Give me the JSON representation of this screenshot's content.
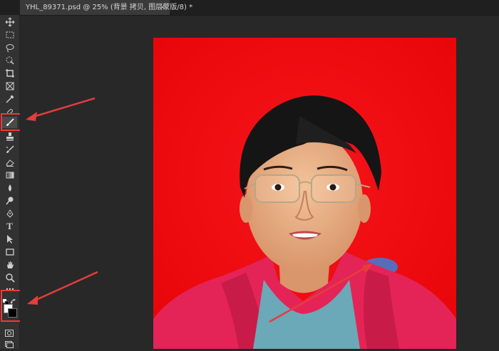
{
  "tab": {
    "title": "YHL_89371.psd @ 25% (背景 拷贝, 图层蒙版/8) *",
    "close_symbol": "×"
  },
  "toolbar": {
    "tools": [
      {
        "name": "move-tool",
        "icon": "move-icon"
      },
      {
        "name": "marquee-tool",
        "icon": "marquee-icon"
      },
      {
        "name": "lasso-tool",
        "icon": "lasso-icon"
      },
      {
        "name": "quick-select-tool",
        "icon": "quick-select-icon"
      },
      {
        "name": "crop-tool",
        "icon": "crop-icon"
      },
      {
        "name": "frame-tool",
        "icon": "frame-icon"
      },
      {
        "name": "eyedropper-tool",
        "icon": "eyedropper-icon"
      },
      {
        "name": "healing-brush-tool",
        "icon": "healing-icon"
      },
      {
        "name": "brush-tool",
        "icon": "brush-icon",
        "active": true
      },
      {
        "name": "clone-stamp-tool",
        "icon": "stamp-icon"
      },
      {
        "name": "history-brush-tool",
        "icon": "history-brush-icon"
      },
      {
        "name": "eraser-tool",
        "icon": "eraser-icon"
      },
      {
        "name": "gradient-tool",
        "icon": "gradient-icon"
      },
      {
        "name": "blur-tool",
        "icon": "blur-icon"
      },
      {
        "name": "dodge-tool",
        "icon": "dodge-icon"
      },
      {
        "name": "pen-tool",
        "icon": "pen-icon"
      },
      {
        "name": "type-tool",
        "icon": "type-icon",
        "label": "T"
      },
      {
        "name": "path-select-tool",
        "icon": "path-select-icon"
      },
      {
        "name": "rectangle-tool",
        "icon": "rectangle-icon"
      },
      {
        "name": "hand-tool",
        "icon": "hand-icon"
      },
      {
        "name": "zoom-tool",
        "icon": "zoom-icon"
      },
      {
        "name": "more-tools",
        "icon": "ellipsis-icon"
      }
    ],
    "foreground_color": "#ffffff",
    "background_color": "#000000"
  },
  "colors": {
    "annotation": "#e63c3c",
    "photo_background": "#f20c10"
  }
}
